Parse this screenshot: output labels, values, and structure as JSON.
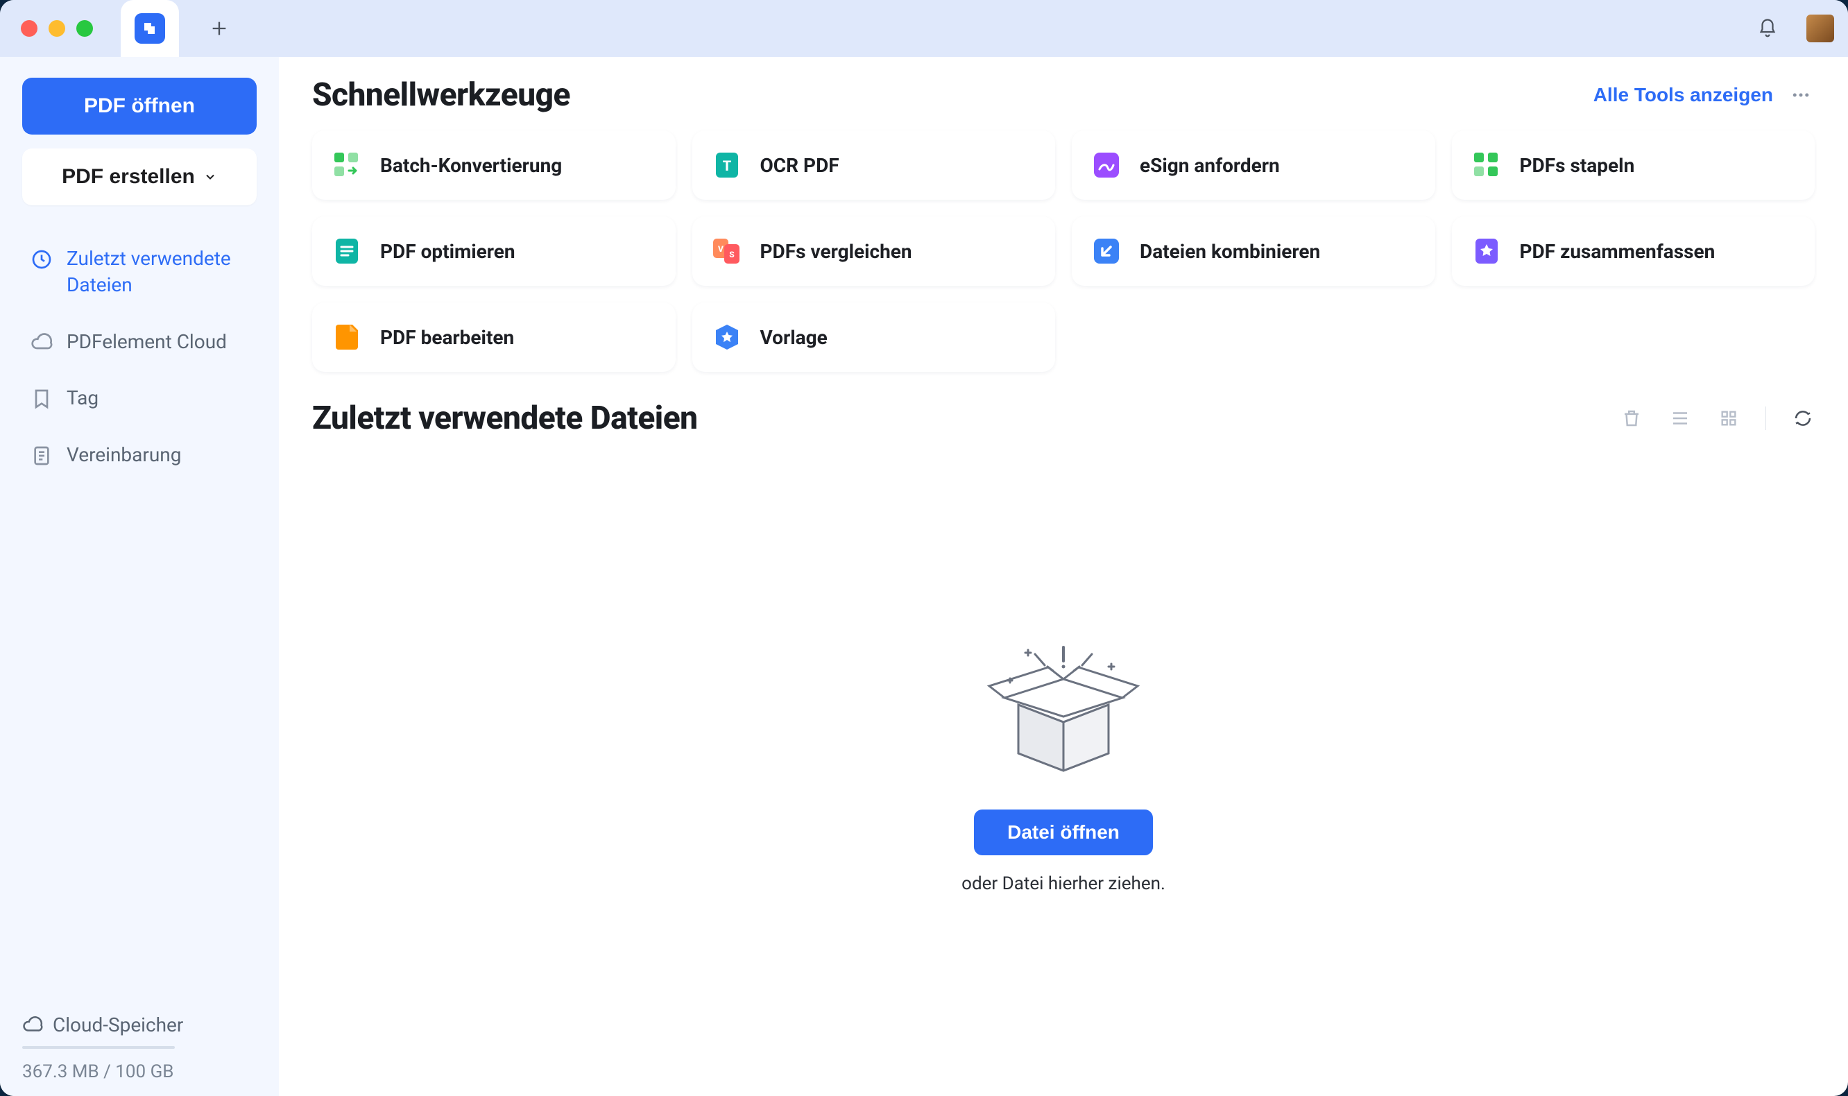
{
  "titlebar": {
    "bell_name": "notifications-icon"
  },
  "sidebar": {
    "open_label": "PDF öffnen",
    "create_label": "PDF erstellen",
    "nav": [
      {
        "label": "Zuletzt verwendete Dateien",
        "icon": "clock-icon",
        "active": true
      },
      {
        "label": "PDFelement Cloud",
        "icon": "cloud-icon",
        "active": false
      },
      {
        "label": "Tag",
        "icon": "bookmark-icon",
        "active": false
      },
      {
        "label": "Vereinbarung",
        "icon": "document-icon",
        "active": false
      }
    ],
    "storage_label": "Cloud-Speicher",
    "storage_info": "367.3 MB / 100 GB"
  },
  "main": {
    "tools_title": "Schnellwerkzeuge",
    "show_all_label": "Alle Tools anzeigen",
    "tools": [
      {
        "label": "Batch-Konvertierung",
        "icon": "batch-convert-icon",
        "color": "#34c759"
      },
      {
        "label": "OCR PDF",
        "icon": "ocr-icon",
        "color": "#0fb5a5"
      },
      {
        "label": "eSign anfordern",
        "icon": "esign-icon",
        "color": "#9b4dff"
      },
      {
        "label": "PDFs stapeln",
        "icon": "stack-icon",
        "color": "#34c759"
      },
      {
        "label": "PDF optimieren",
        "icon": "optimize-icon",
        "color": "#0fb5a5"
      },
      {
        "label": "PDFs vergleichen",
        "icon": "compare-icon",
        "color": "#ff5a5f"
      },
      {
        "label": "Dateien kombinieren",
        "icon": "combine-icon",
        "color": "#3b82f6"
      },
      {
        "label": "PDF zusammenfassen",
        "icon": "summarize-icon",
        "color": "#7c5cff"
      },
      {
        "label": "PDF bearbeiten",
        "icon": "edit-icon",
        "color": "#ff9500"
      },
      {
        "label": "Vorlage",
        "icon": "template-icon",
        "color": "#3b82f6"
      }
    ],
    "recent_title": "Zuletzt verwendete Dateien",
    "recent_toolbar": {
      "delete": "trash-icon",
      "list": "list-view-icon",
      "grid": "grid-view-icon",
      "refresh": "refresh-icon"
    },
    "empty": {
      "open_label": "Datei öffnen",
      "hint": "oder Datei hierher ziehen."
    }
  }
}
